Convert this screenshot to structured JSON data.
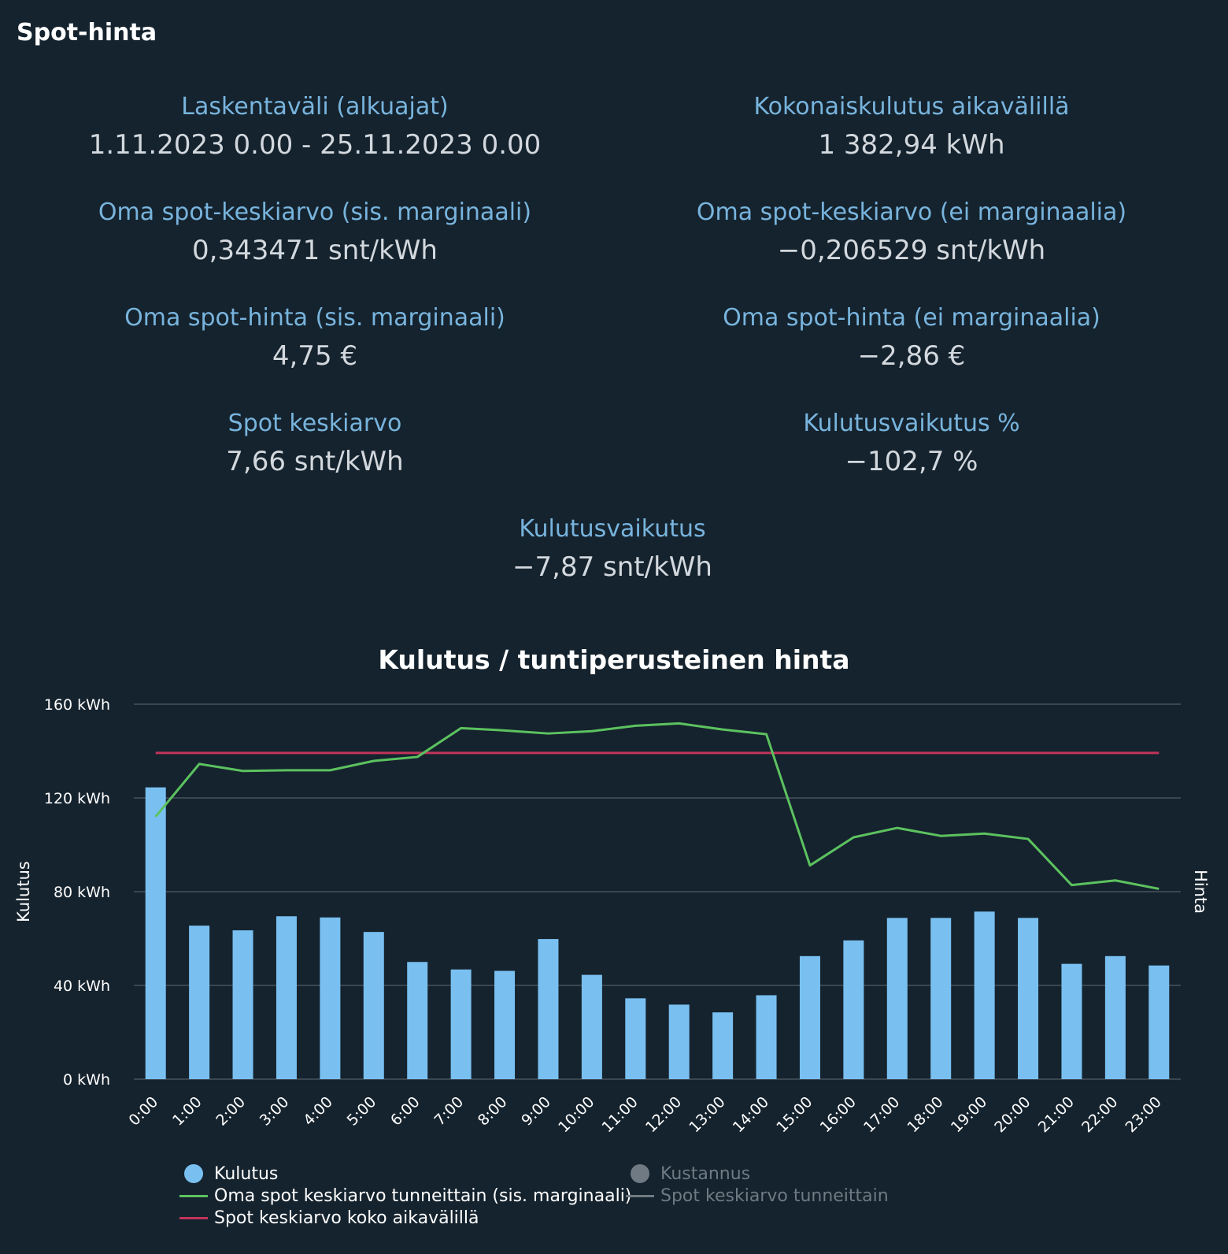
{
  "card": {
    "title": "Spot-hinta"
  },
  "stats": [
    {
      "label": "Laskentaväli (alkuajat)",
      "value": "1.11.2023 0.00 - 25.11.2023 0.00"
    },
    {
      "label": "Kokonaiskulutus aikavälillä",
      "value": "1 382,94 kWh"
    },
    {
      "label": "Oma spot-keskiarvo (sis. marginaali)",
      "value": "0,343471 snt/kWh"
    },
    {
      "label": "Oma spot-keskiarvo (ei marginaalia)",
      "value": "−0,206529 snt/kWh"
    },
    {
      "label": "Oma spot-hinta (sis. marginaali)",
      "value": "4,75 €"
    },
    {
      "label": "Oma spot-hinta (ei marginaalia)",
      "value": "−2,86 €"
    },
    {
      "label": "Spot keskiarvo",
      "value": "7,66 snt/kWh"
    },
    {
      "label": "Kulutusvaikutus %",
      "value": "−102,7 %"
    },
    {
      "label": "Kulutusvaikutus",
      "value": "−7,87 snt/kWh"
    }
  ],
  "chart_data": {
    "type": "bar",
    "title": "Kulutus / tuntiperusteinen hinta",
    "ylabel": "Kulutus",
    "y2label": "Hinta",
    "ylim": [
      0,
      160
    ],
    "yticks": [
      "0 kWh",
      "40 kWh",
      "80 kWh",
      "120 kWh",
      "160 kWh"
    ],
    "ytick_values": [
      0,
      40,
      80,
      120,
      160
    ],
    "categories": [
      "0:00",
      "1:00",
      "2:00",
      "3:00",
      "4:00",
      "5:00",
      "6:00",
      "7:00",
      "8:00",
      "9:00",
      "10:00",
      "11:00",
      "12:00",
      "13:00",
      "14:00",
      "15:00",
      "16:00",
      "17:00",
      "18:00",
      "19:00",
      "20:00",
      "21:00",
      "22:00",
      "23:00"
    ],
    "grid": true,
    "legend_position": "bottom",
    "series": [
      {
        "name": "Kulutus",
        "type": "bar",
        "axis": "left",
        "color": "#79c0f1",
        "values": [
          124.5,
          65.5,
          63.5,
          69.5,
          69,
          62.8,
          50,
          46.8,
          46.2,
          59.8,
          44.5,
          34.5,
          31.8,
          28.5,
          35.8,
          52.5,
          59.2,
          68.8,
          68.8,
          71.5,
          68.8,
          49.2,
          52.5,
          48.5
        ]
      },
      {
        "name": "Oma spot keskiarvo tunneittain (sis. marginaali)",
        "type": "line",
        "axis": "right",
        "color": "#5cc25f",
        "values": [
          112,
          134.5,
          131.5,
          131.8,
          131.8,
          135.8,
          137.5,
          149.8,
          148.8,
          147.5,
          148.5,
          150.8,
          151.8,
          149.2,
          147.2,
          91.2,
          103.2,
          107.2,
          103.8,
          104.8,
          102.5,
          82.8,
          84.8,
          81.2
        ]
      },
      {
        "name": "Spot keskiarvo koko aikavälillä",
        "type": "line",
        "axis": "right",
        "color": "#c2335a",
        "values": [
          139.2,
          139.2,
          139.2,
          139.2,
          139.2,
          139.2,
          139.2,
          139.2,
          139.2,
          139.2,
          139.2,
          139.2,
          139.2,
          139.2,
          139.2,
          139.2,
          139.2,
          139.2,
          139.2,
          139.2,
          139.2,
          139.2,
          139.2,
          139.2
        ]
      },
      {
        "name": "Kustannus",
        "type": "bar",
        "hidden": true,
        "color": "#6f7a83",
        "values": []
      },
      {
        "name": "Spot keskiarvo tunneittain",
        "type": "line",
        "hidden": true,
        "color": "#6f7a83",
        "values": []
      }
    ]
  },
  "colors": {
    "background": "#15232e",
    "label": "#78b4dd",
    "value": "#d2d8dd",
    "grid": "#46525c"
  }
}
